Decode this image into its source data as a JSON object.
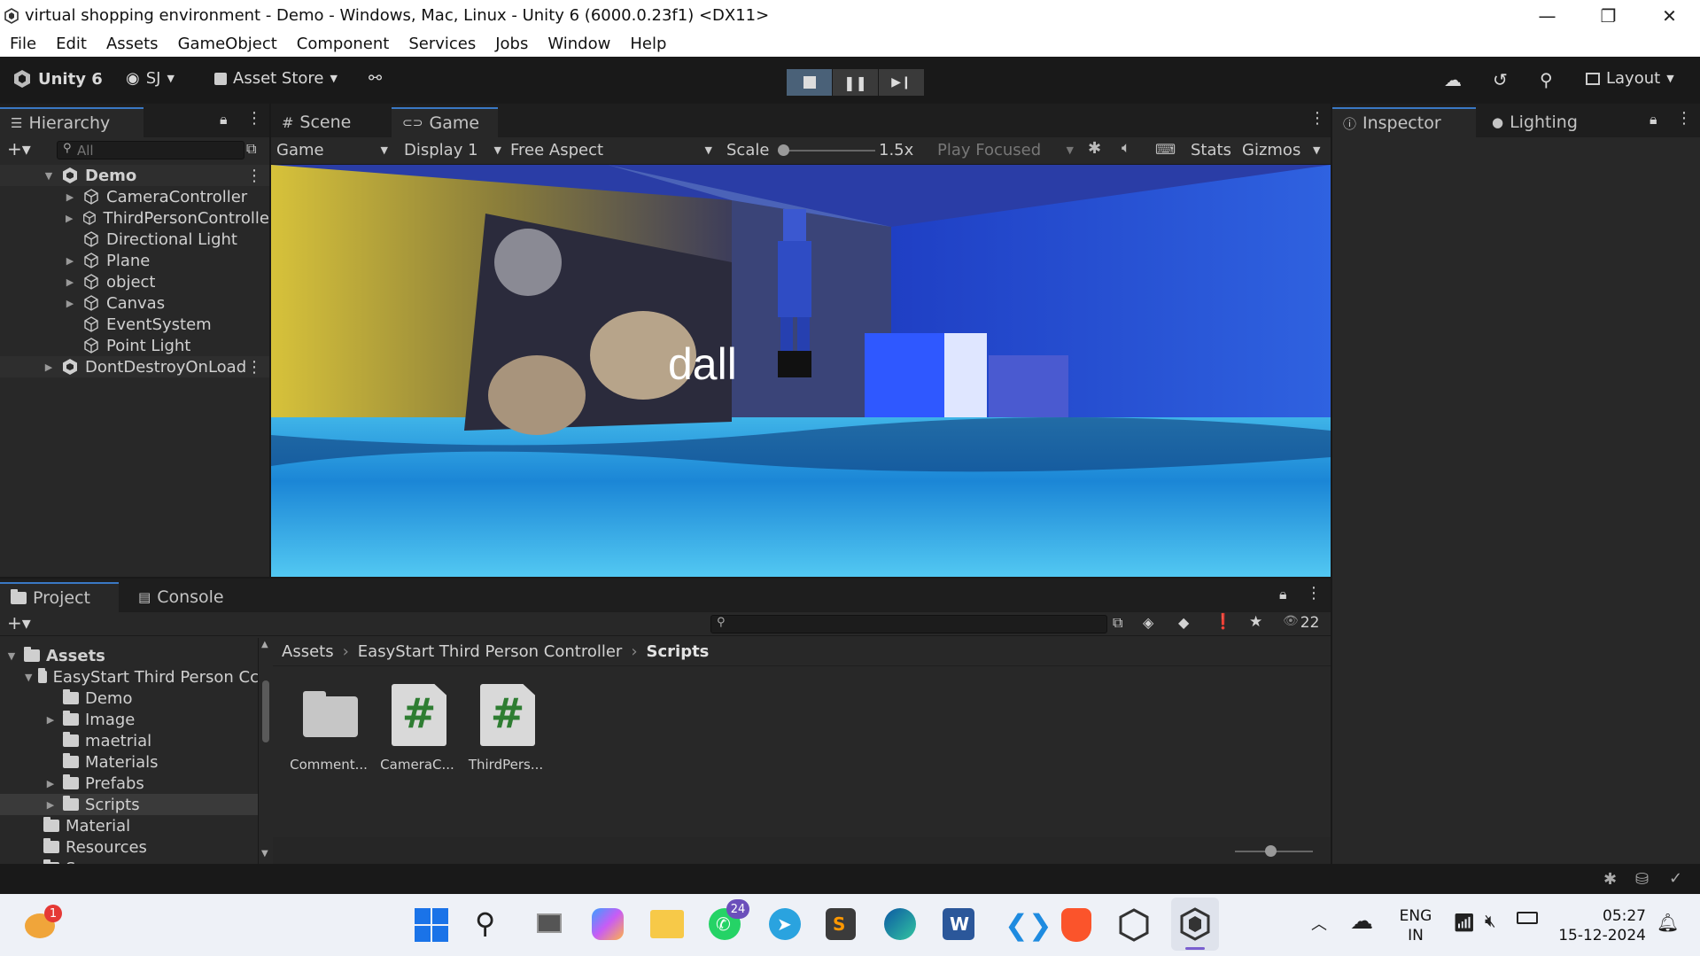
{
  "window": {
    "title": "virtual shopping environment - Demo - Windows, Mac, Linux - Unity 6 (6000.0.23f1) <DX11>",
    "controls": [
      "—",
      "❐",
      "✕"
    ]
  },
  "menu": [
    "File",
    "Edit",
    "Assets",
    "GameObject",
    "Component",
    "Services",
    "Jobs",
    "Window",
    "Help"
  ],
  "toolbar": {
    "unity_label": "Unity 6",
    "account": "SJ",
    "asset_store": "Asset Store",
    "layout": "Layout"
  },
  "hierarchy": {
    "tab": "Hierarchy",
    "search_placeholder": "All",
    "items": [
      {
        "label": "Demo",
        "depth": 0,
        "bold": true,
        "expanded": true,
        "scene": true
      },
      {
        "label": "CameraController",
        "depth": 1,
        "arrow": true
      },
      {
        "label": "ThirdPersonControlle",
        "depth": 1,
        "arrow": true
      },
      {
        "label": "Directional Light",
        "depth": 1,
        "arrow": false
      },
      {
        "label": "Plane",
        "depth": 1,
        "arrow": true
      },
      {
        "label": "object",
        "depth": 1,
        "arrow": true
      },
      {
        "label": "Canvas",
        "depth": 1,
        "arrow": true
      },
      {
        "label": "EventSystem",
        "depth": 1,
        "arrow": false
      },
      {
        "label": "Point Light",
        "depth": 1,
        "arrow": false
      },
      {
        "label": "DontDestroyOnLoad",
        "depth": 0,
        "bold": false,
        "expanded": false,
        "scene": true
      }
    ]
  },
  "game_view": {
    "tabs": {
      "scene": "Scene",
      "game": "Game"
    },
    "game_dropdown": "Game",
    "display": "Display 1",
    "aspect": "Free Aspect",
    "scale_label": "Scale",
    "scale_value": "1.5x",
    "play_mode": "Play Focused",
    "stats": "Stats",
    "gizmos": "Gizmos",
    "overlay_text": "dall"
  },
  "inspector": {
    "tabs": {
      "inspector": "Inspector",
      "lighting": "Lighting"
    }
  },
  "project": {
    "tabs": {
      "project": "Project",
      "console": "Console"
    },
    "hidden_count": "22",
    "tree": [
      {
        "label": "Assets",
        "depth": 0,
        "bold": true,
        "arrow": "down"
      },
      {
        "label": "EasyStart Third Person Cc",
        "depth": 1,
        "arrow": "down"
      },
      {
        "label": "Demo",
        "depth": 2,
        "arrow": ""
      },
      {
        "label": "Image",
        "depth": 2,
        "arrow": "right"
      },
      {
        "label": "maetrial",
        "depth": 2,
        "arrow": ""
      },
      {
        "label": "Materials",
        "depth": 2,
        "arrow": ""
      },
      {
        "label": "Prefabs",
        "depth": 2,
        "arrow": "right"
      },
      {
        "label": "Scripts",
        "depth": 2,
        "arrow": "right",
        "selected": true
      },
      {
        "label": "Material",
        "depth": 1,
        "arrow": ""
      },
      {
        "label": "Resources",
        "depth": 1,
        "arrow": ""
      },
      {
        "label": "Scenes",
        "depth": 1,
        "arrow": ""
      }
    ],
    "breadcrumb": [
      "Assets",
      "EasyStart Third Person Controller",
      "Scripts"
    ],
    "files": [
      {
        "label": "Comment...",
        "type": "folder"
      },
      {
        "label": "CameraC...",
        "type": "script"
      },
      {
        "label": "ThirdPers...",
        "type": "script"
      }
    ]
  },
  "taskbar": {
    "weather_badge": "1",
    "whatsapp_badge": "24",
    "lang_line1": "ENG",
    "lang_line2": "IN",
    "time": "05:27",
    "date": "15-12-2024"
  },
  "colors": {
    "editor_bg": "#191919",
    "panel_bg": "#282828",
    "accent": "#3a78c4",
    "taskbar_bg": "#eef1f7"
  }
}
